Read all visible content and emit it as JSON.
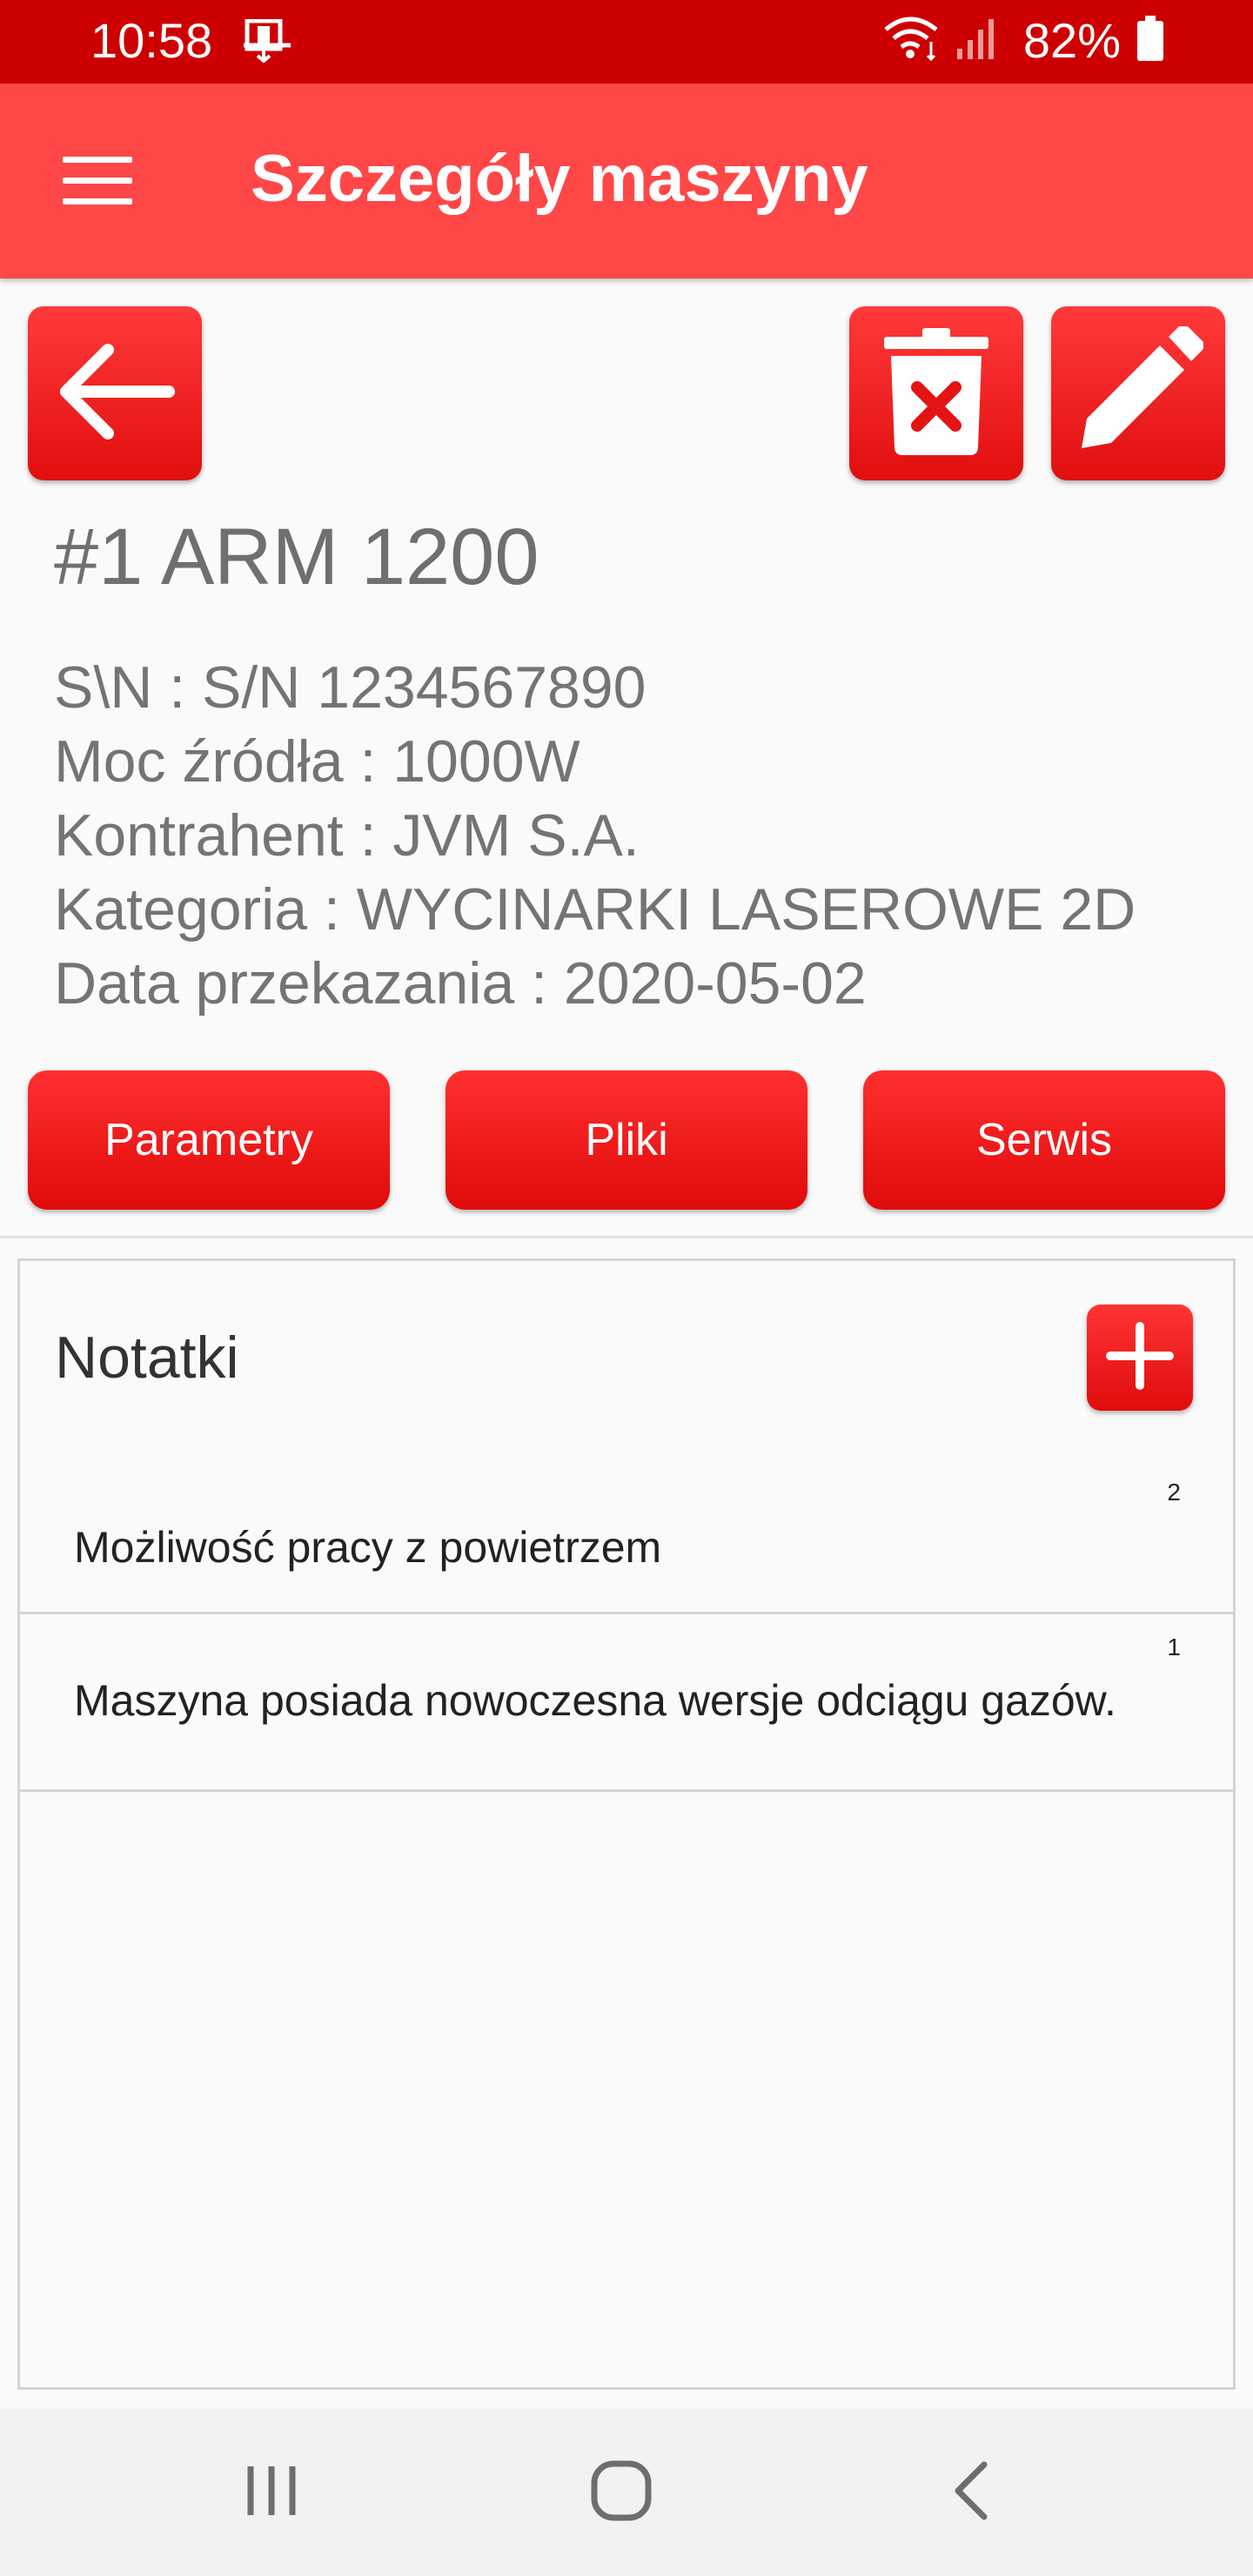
{
  "status_bar": {
    "time": "10:58",
    "battery": "82%"
  },
  "app_bar": {
    "title": "Szczegóły maszyny"
  },
  "machine": {
    "title": "#1 ARM 1200",
    "info": [
      "S\\N : S/N 1234567890",
      "Moc źródła : 1000W",
      "Kontrahent : JVM S.A.",
      "Kategoria : WYCINARKI LASEROWE 2D",
      "Data przekazania : 2020-05-02"
    ]
  },
  "tabs": [
    {
      "label": "Parametry"
    },
    {
      "label": "Pliki"
    },
    {
      "label": "Serwis"
    }
  ],
  "notes": {
    "title": "Notatki",
    "items": [
      {
        "number": "2",
        "text": "Możliwość pracy z powietrzem"
      },
      {
        "number": "1",
        "text": "Maszyna posiada nowoczesna wersje odciągu gazów."
      }
    ]
  },
  "colors": {
    "status_bar": "#cc0000",
    "app_bar": "#ff4747",
    "accent": "#e60f0f"
  },
  "icons": {
    "menu": "hamburger-menu-icon",
    "back": "arrow-left-icon",
    "delete": "trash-x-icon",
    "edit": "pencil-icon",
    "add": "plus-icon"
  }
}
